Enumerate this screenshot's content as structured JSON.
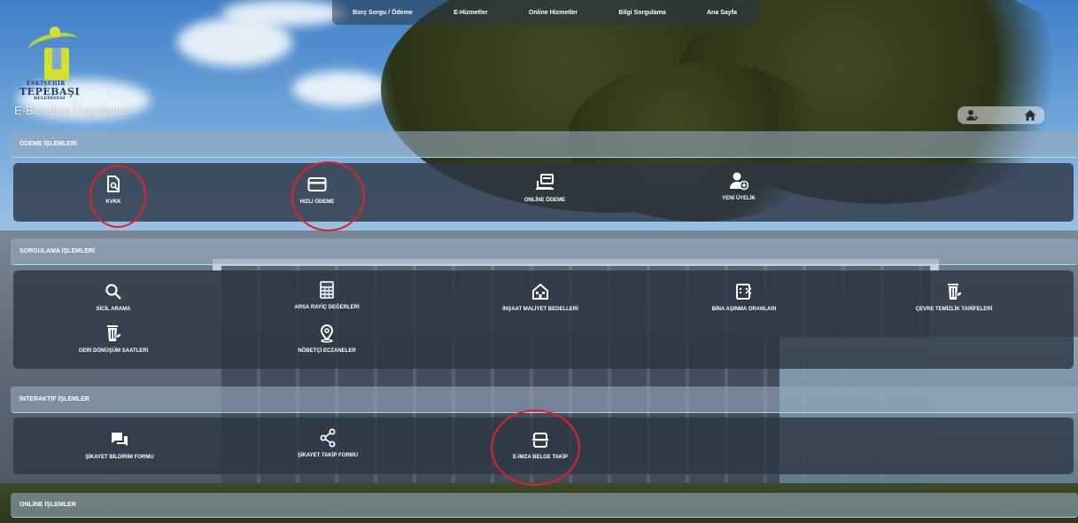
{
  "top_nav": [
    {
      "label": "Borç Sorgu / Ödeme"
    },
    {
      "label": "E-Hizmetler"
    },
    {
      "label": "Online Hizmetler"
    },
    {
      "label": "Bilgi Sorgulama"
    },
    {
      "label": "Ana Sayfa"
    }
  ],
  "logo": {
    "city": "ESKİŞEHİR",
    "name": "TEPEBAŞI",
    "sub": "BELEDİYESİ",
    "app_name": "E-Belediye Uygulaması"
  },
  "user_buttons": {
    "icons": [
      "user-icon",
      "home-icon"
    ]
  },
  "sections": {
    "odeme": {
      "title": "ÖDEME İŞLEMLERİ",
      "items": [
        {
          "label": "KVKK",
          "icon": "document-search-icon"
        },
        {
          "label": "HIZLI ÖDEME",
          "icon": "credit-card-icon"
        },
        {
          "label": "ONLİNE ÖDEME",
          "icon": "laptop-payment-icon"
        },
        {
          "label": "YENİ ÜYELİK",
          "icon": "add-user-icon"
        }
      ]
    },
    "sorgulama": {
      "title": "SORGULAMA İŞLEMLERİ",
      "items": [
        {
          "label": "SİCİL ARAMA",
          "icon": "search-icon"
        },
        {
          "label": "ARSA RAYİÇ DEĞERLERİ",
          "icon": "calculator-icon"
        },
        {
          "label": "İNŞAAT MALİYET BEDELLERİ",
          "icon": "house-icon"
        },
        {
          "label": "BİNA AŞINMA ORANLARI",
          "icon": "percent-icon"
        },
        {
          "label": "ÇEVRE TEMİZLİK TARİFELERİ",
          "icon": "trash-eco-icon"
        },
        {
          "label": "GERİ DÖNÜŞÜM SAATLERİ",
          "icon": "recycle-bin-icon"
        },
        {
          "label": "NÖBETÇİ ECZANELER",
          "icon": "location-pin-icon"
        }
      ]
    },
    "interaktif": {
      "title": "İNTERAKTİF İŞLEMLER",
      "items": [
        {
          "label": "ŞİKAYET BİLDİRİM FORMU",
          "icon": "chat-icon"
        },
        {
          "label": "ŞİKAYET TAKİP FORMU",
          "icon": "share-icon"
        },
        {
          "label": "E-İMZA BELGE TAKİP",
          "icon": "document-stack-icon"
        }
      ]
    },
    "online": {
      "title": "ONLİNE İŞLEMLER"
    }
  },
  "colors": {
    "annotation": "#e0202a",
    "panel": "#2d3744",
    "section_bar": "#96aabe"
  }
}
